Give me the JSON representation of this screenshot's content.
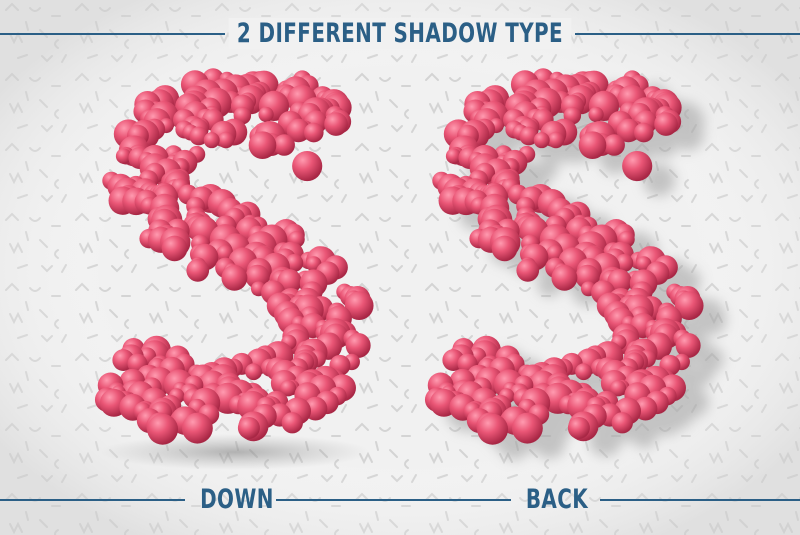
{
  "title": "2 DIFFERENT SHADOW TYPE",
  "labels": {
    "left": "DOWN",
    "right": "BACK"
  },
  "colors": {
    "accent": "#2b5f86",
    "ball": "#e8506f",
    "background": "#f1f1f1",
    "pattern": "#d6d6d6"
  },
  "letters": [
    {
      "glyph": "S",
      "shadow": "down"
    },
    {
      "glyph": "S",
      "shadow": "back"
    }
  ]
}
